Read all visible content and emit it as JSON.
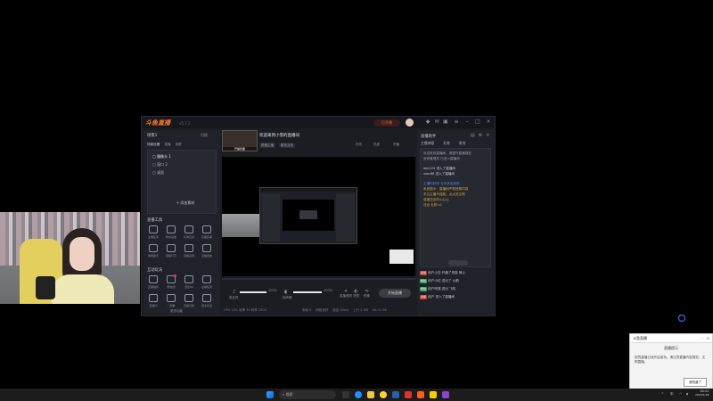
{
  "app": {
    "logo": "斗鱼直播",
    "version": "v5.7.2",
    "live_pill": "已开播",
    "title_icons": [
      "gift-icon",
      "mail-icon",
      "skin-icon",
      "menu-icon",
      "minimize-icon",
      "maximize-icon",
      "close-icon"
    ]
  },
  "left_panel": {
    "scene_header": "场景1",
    "scene_dropdown": "切换",
    "scene_tabs": [
      "场景设置",
      "直播",
      "录屏"
    ],
    "sources": [
      "摄像头 1",
      "窗口 2",
      "桌面"
    ],
    "add_source": "+ 添加素材",
    "tools_header": "直播工具",
    "tools_row1": [
      "主播任务",
      "粉丝勋章",
      "礼物互动",
      "直播投票"
    ],
    "tools_row2": [
      "弹幕助手",
      "直播打赏",
      "直播设置",
      "直播回放"
    ],
    "section2_header": "互动玩法",
    "tools_row3": [
      "直播抽奖",
      "粉丝团",
      "连麦PK",
      "主播任务"
    ],
    "tools_row4": [
      "直播间",
      "一起看",
      "直播竞猜",
      "更多玩法"
    ],
    "more_label": "更多功能"
  },
  "center": {
    "cover_label": "开播封面",
    "room_title": "欢迎来到小雪的直播间",
    "tags": [
      "颜值主播",
      "聊天互动"
    ],
    "header_right": [
      "在线",
      "热度",
      "开播"
    ],
    "mic_label": "麦克风",
    "mic_value": "100%",
    "speaker_label": "扬声器",
    "speaker_value": "100%",
    "bottom_tools": [
      "直播美颜",
      "滤镜",
      "镜像",
      "设置"
    ],
    "live_button": "开始直播",
    "status_left": "CPU 12%  帧率 30  码率 2500",
    "status_right": [
      "丢帧 0",
      "网络良好",
      "延迟 45ms",
      "上行 2.5M",
      "00:21:36"
    ]
  },
  "right_panel": {
    "header": "直播助手",
    "tabs": [
      "主播弹幕",
      "礼物",
      "贵宾"
    ],
    "chat": [
      {
        "text": "欢迎来到直播间，请遵守直播规范",
        "color": "#9aa0aa"
      },
      {
        "text": "房间管理员 已进入直播间",
        "color": "#9aa0aa"
      },
      {
        "text": "abc123 进入了直播间",
        "color": "#c8ccd4"
      },
      {
        "text": "user88 进入了直播间",
        "color": "#c8ccd4"
      },
      {
        "text": "主播你好呀 今天状态真好",
        "color": "#4f8cff"
      },
      {
        "text": "系统提示：直播间严禁违规内容",
        "color": "#d9a441"
      },
      {
        "text": "关注主播不迷路，点点关注吧",
        "color": "#d9a441"
      },
      {
        "text": "感谢送出的小心心",
        "color": "#d9a441"
      },
      {
        "text": "送出 礼物 x1",
        "color": "#d9a441"
      }
    ],
    "gifts": [
      {
        "badge": "贵族",
        "text": "用户小白 开通了贵族 骑士"
      },
      {
        "badge": "粉丝",
        "text": "用户小红 送出了 火箭"
      },
      {
        "badge": "粉丝",
        "text": "用户阿强 送出 飞机"
      },
      {
        "badge": "贵族",
        "text": "用户 进入了直播间"
      }
    ]
  },
  "popup": {
    "title": "斗鱼直播",
    "heading": "直播提示",
    "body": "您的直播已经开启成功，请注意直播内容规范，文明直播。",
    "ok": "我知道了"
  },
  "taskbar": {
    "search_placeholder": "搜索",
    "time": "18:31",
    "date": "2024/1/18",
    "lang": "中"
  },
  "colors": {
    "accent": "#ff7a2e",
    "live_red": "#ff5b3a",
    "chat_gold": "#d9a441",
    "chat_blue": "#4f8cff"
  }
}
